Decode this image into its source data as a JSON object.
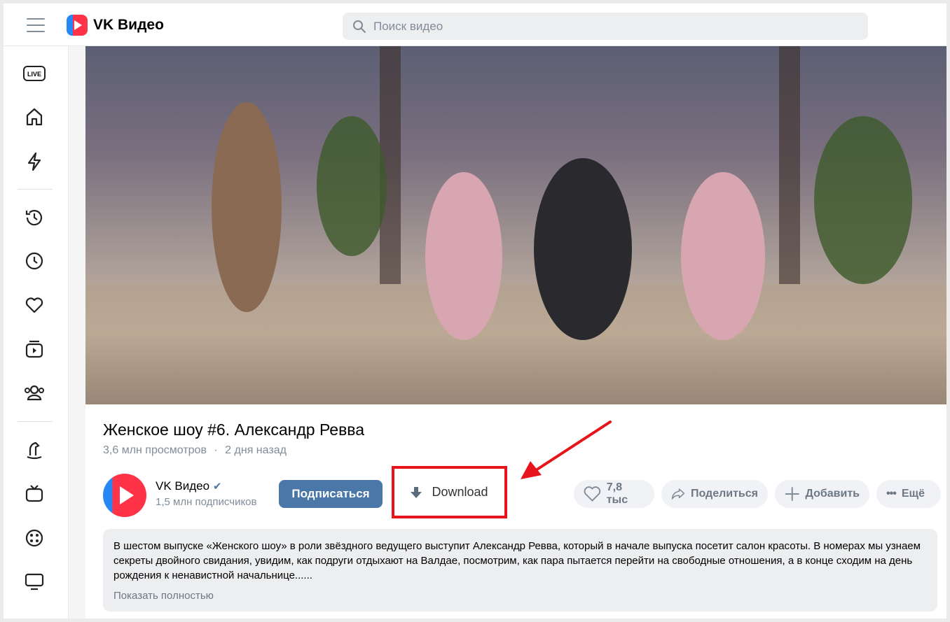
{
  "header": {
    "logo_text": "VK Видео",
    "search_placeholder": "Поиск видео"
  },
  "sidebar": {
    "items": [
      "live",
      "home",
      "shorts",
      "history",
      "watch-later",
      "liked",
      "my-videos",
      "subscriptions",
      "kids",
      "tv",
      "movies",
      "screen"
    ]
  },
  "video": {
    "title": "Женское шоу #6. Александр Ревва",
    "views": "3,6 млн просмотров",
    "separator": "·",
    "date": "2 дня назад",
    "channel": {
      "name": "VK Видео",
      "verified": true,
      "subscribers": "1,5 млн подписчиков"
    },
    "subscribe_label": "Подписаться",
    "download_label": "Download",
    "likes": "7,8 тыс",
    "share_label": "Поделиться",
    "add_label": "Добавить",
    "more_label": "Ещё",
    "description": "В шестом выпуске «Женского шоу» в роли звёздного ведущего выступит Александр Ревва, который в начале выпуска посетит салон красоты. В номерах мы узнаем секреты двойного свидания, увидим, как подруги отдыхают на Валдае, посмотрим, как пара пытается перейти на свободные отношения, а в конце сходим на день рождения к ненавистной начальнице......",
    "show_more": "Показать полностью"
  },
  "colors": {
    "accent": "#4a76a8",
    "highlight": "#e8141c",
    "brand_red": "#ff3347",
    "brand_blue": "#2787f5"
  }
}
